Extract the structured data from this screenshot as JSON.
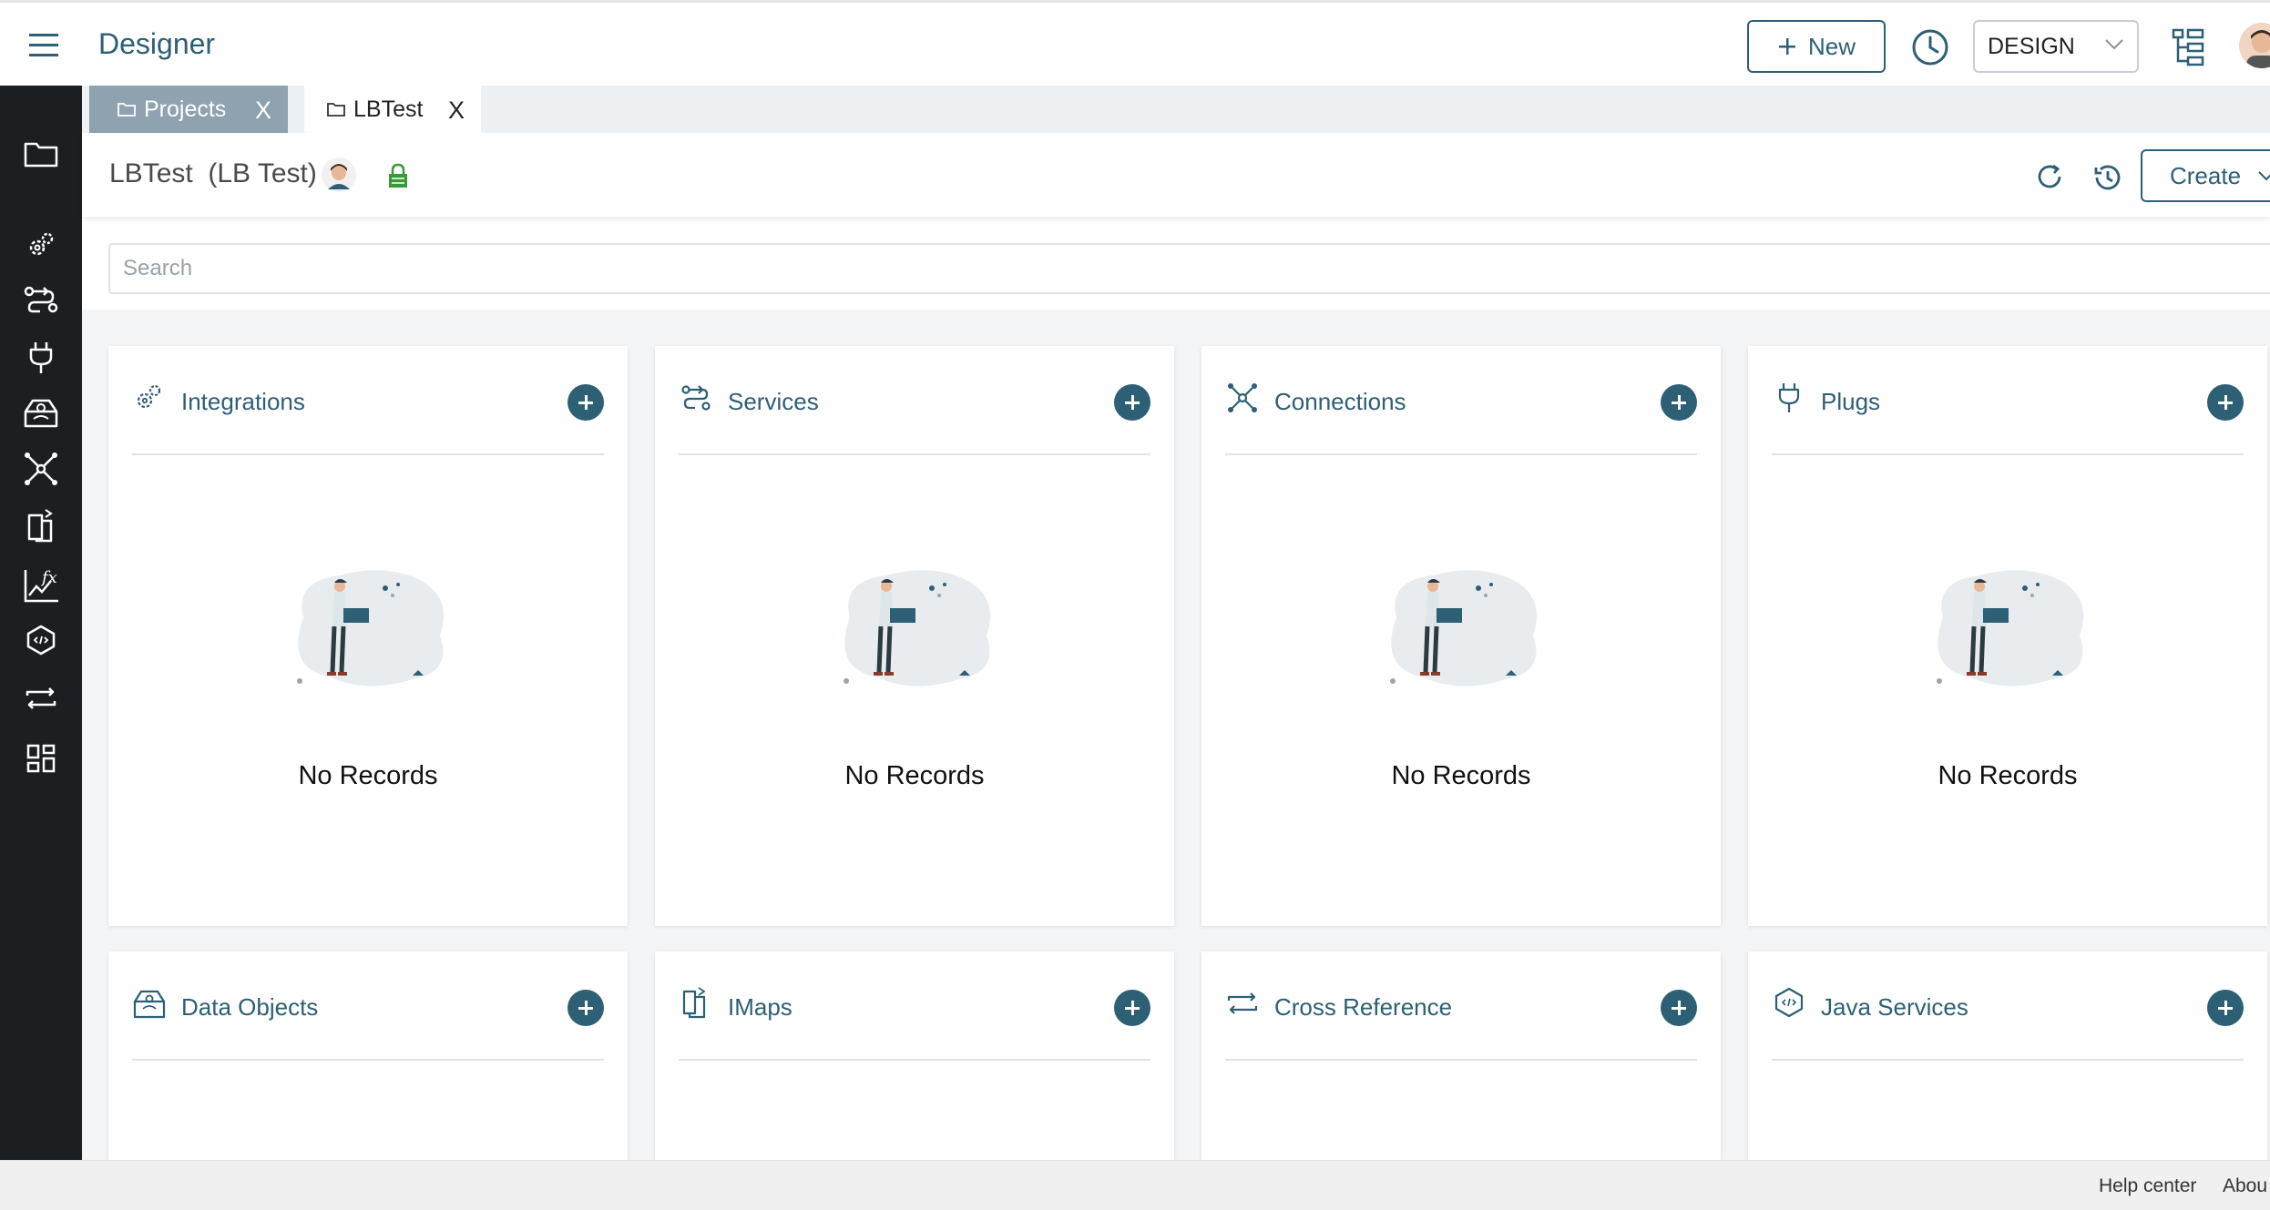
{
  "header": {
    "app_title": "Designer",
    "new_label": "New",
    "mode": "DESIGN"
  },
  "tabs": [
    {
      "label": "Projects",
      "close": "X",
      "active": false
    },
    {
      "label": "LBTest",
      "close": "X",
      "active": true
    }
  ],
  "project": {
    "title": "LBTest  (LB Test)",
    "create_label": "Create"
  },
  "search": {
    "placeholder": "Search"
  },
  "cards": [
    {
      "title": "Integrations",
      "icon": "gears-icon",
      "empty_text": "No Records"
    },
    {
      "title": "Services",
      "icon": "services-icon",
      "empty_text": "No Records"
    },
    {
      "title": "Connections",
      "icon": "network-icon",
      "empty_text": "No Records"
    },
    {
      "title": "Plugs",
      "icon": "plug-icon",
      "empty_text": "No Records"
    },
    {
      "title": "Data Objects",
      "icon": "data-objects-icon"
    },
    {
      "title": "IMaps",
      "icon": "imaps-icon"
    },
    {
      "title": "Cross Reference",
      "icon": "cross-reference-icon"
    },
    {
      "title": "Java Services",
      "icon": "java-services-icon"
    }
  ],
  "sidebar": {
    "icons": [
      "folder-icon",
      "gears-icon",
      "services-icon",
      "plug-icon",
      "data-objects-icon",
      "network-icon",
      "imaps-icon",
      "function-icon",
      "java-services-icon",
      "cross-reference-icon",
      "dashboard-icon"
    ]
  },
  "footer": {
    "help": "Help center",
    "about": "Abou"
  },
  "colors": {
    "accent": "#2d5f75",
    "sidebar": "#1b1f22",
    "tab_inactive": "#8ea2b0"
  }
}
